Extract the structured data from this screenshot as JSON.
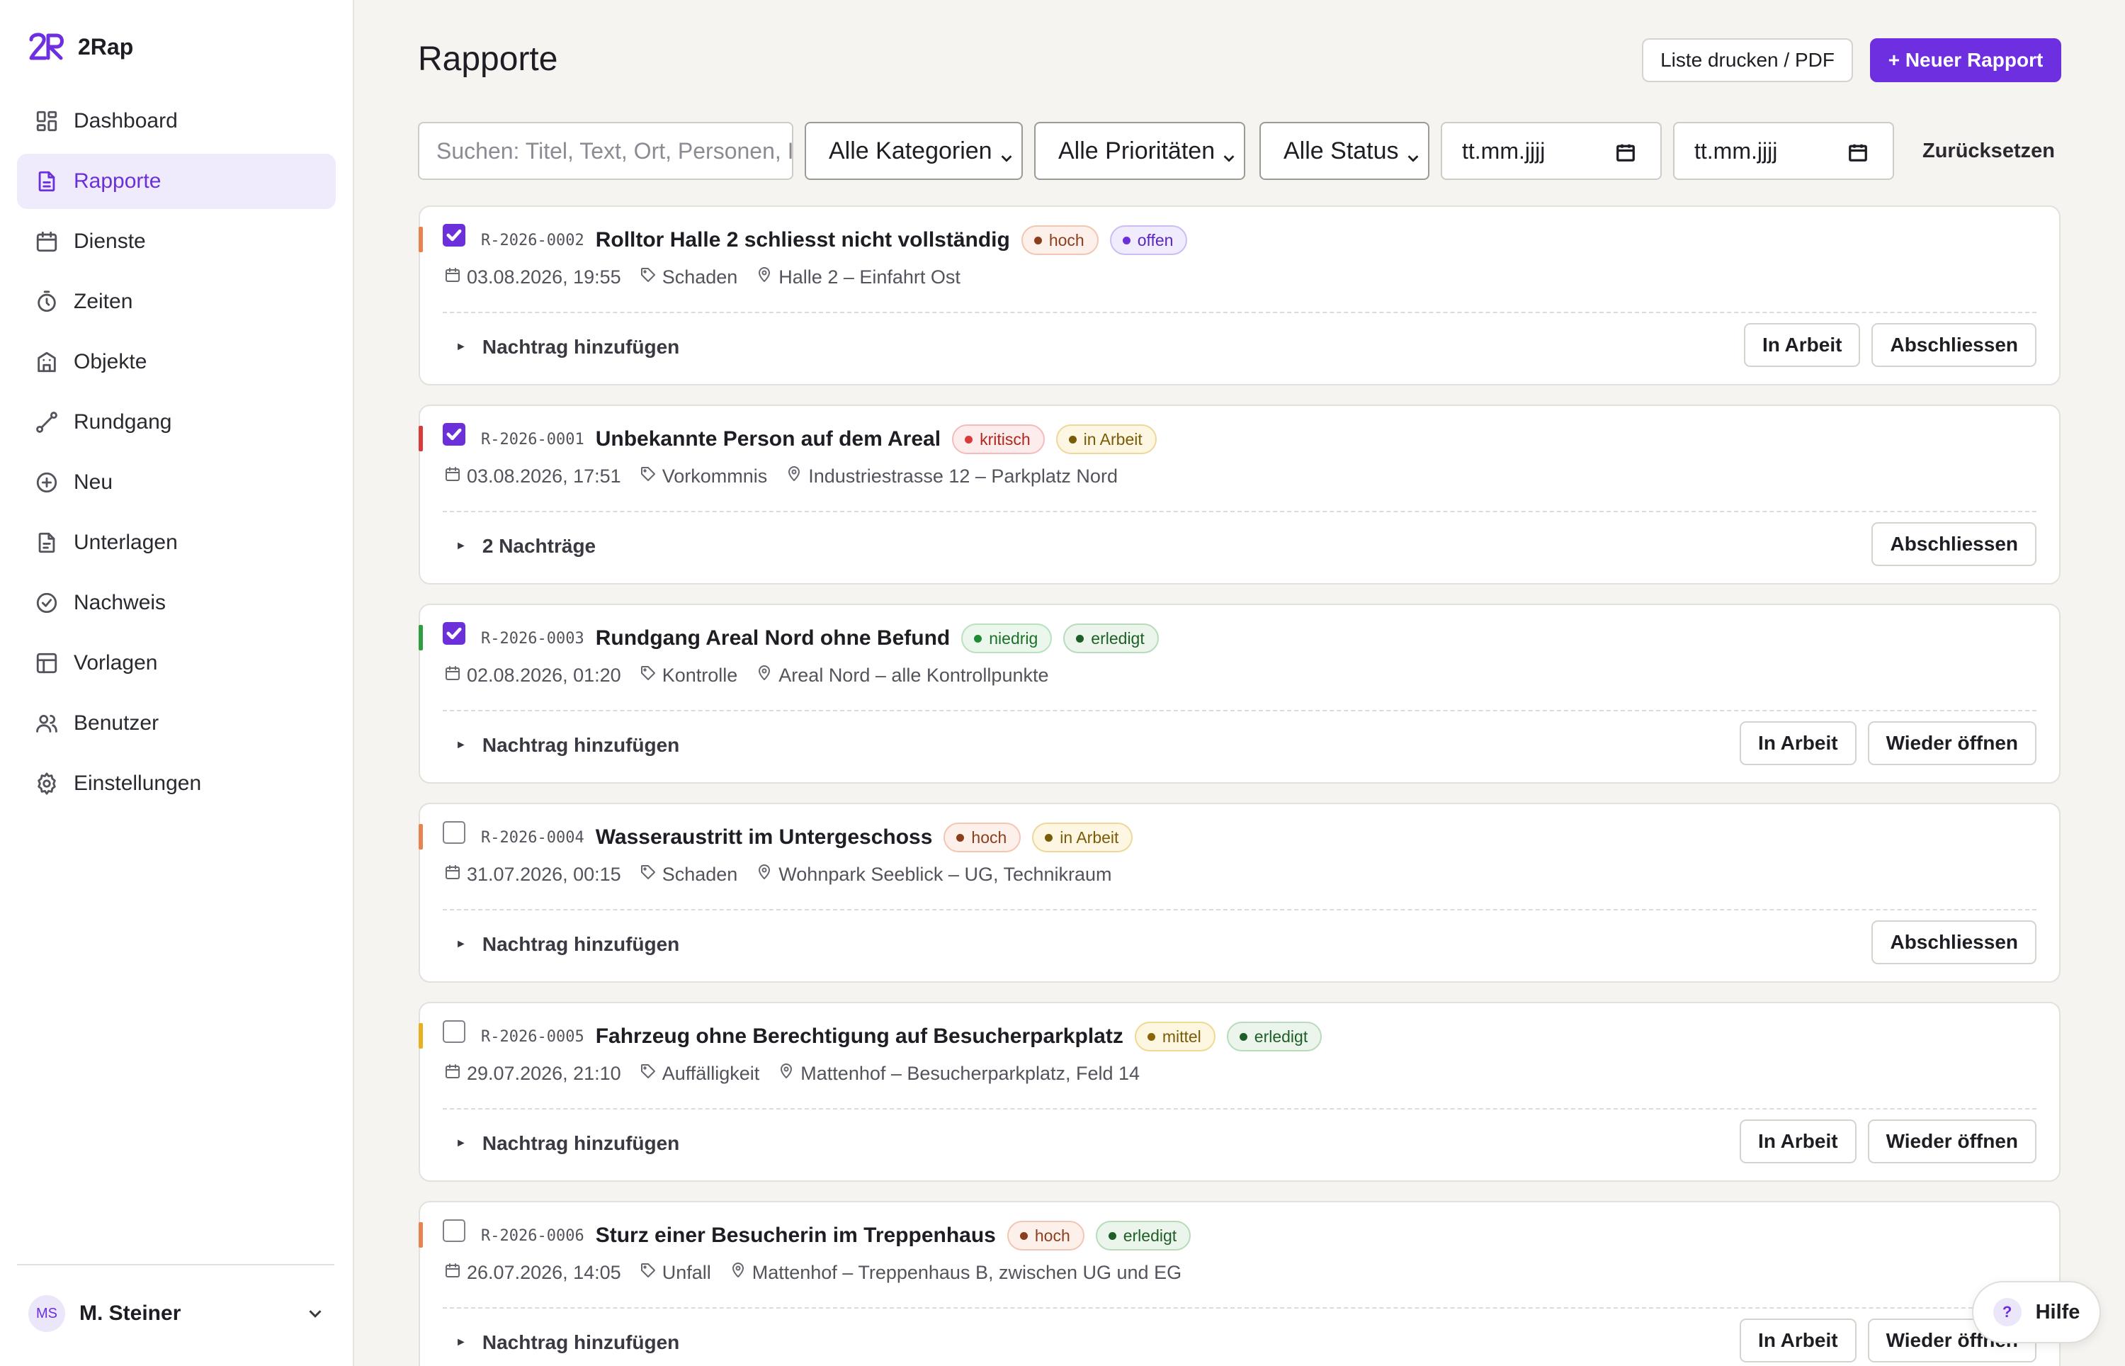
{
  "app": {
    "name": "2Rap"
  },
  "sidebar": {
    "items": [
      {
        "label": "Dashboard",
        "icon": "dashboard-icon"
      },
      {
        "label": "Rapporte",
        "icon": "document-icon",
        "active": true
      },
      {
        "label": "Dienste",
        "icon": "calendar-icon"
      },
      {
        "label": "Zeiten",
        "icon": "stopwatch-icon"
      },
      {
        "label": "Objekte",
        "icon": "building-icon"
      },
      {
        "label": "Rundgang",
        "icon": "route-icon"
      },
      {
        "label": "Neu",
        "icon": "plus-circle-icon"
      },
      {
        "label": "Unterlagen",
        "icon": "file-icon"
      },
      {
        "label": "Nachweis",
        "icon": "check-circle-icon"
      },
      {
        "label": "Vorlagen",
        "icon": "layout-icon"
      },
      {
        "label": "Benutzer",
        "icon": "users-icon"
      },
      {
        "label": "Einstellungen",
        "icon": "gear-icon"
      }
    ],
    "user": {
      "initials": "MS",
      "name": "M. Steiner"
    }
  },
  "header": {
    "title": "Rapporte",
    "print_label": "Liste drucken / PDF",
    "new_label": "+ Neuer Rapport"
  },
  "filters": {
    "search_placeholder": "Suchen: Titel, Text, Ort, Personen, I",
    "category": "Alle Kategorien",
    "priority": "Alle Prioritäten",
    "status": "Alle Status",
    "date_from": "tt.mm.jjjj",
    "date_to": "tt.mm.jjjj",
    "reset_label": "Zurücksetzen"
  },
  "colors": {
    "accent": "#6d2fe0",
    "priority_hoch": "#e8834e",
    "priority_kritisch": "#d93a3a",
    "priority_niedrig": "#2f9e41",
    "priority_mittel": "#e6b020"
  },
  "reports": [
    {
      "id": "R-2026-0002",
      "title": "Rolltor Halle 2 schliesst nicht vollständig",
      "priority": "hoch",
      "status": "offen",
      "checked": true,
      "date": "03.08.2026, 19:55",
      "category": "Schaden",
      "location": "Halle 2 – Einfahrt Ost",
      "footer": "Nachtrag hinzufügen",
      "actions": [
        "In Arbeit",
        "Abschliessen"
      ]
    },
    {
      "id": "R-2026-0001",
      "title": "Unbekannte Person auf dem Areal",
      "priority": "kritisch",
      "status": "in Arbeit",
      "checked": true,
      "date": "03.08.2026, 17:51",
      "category": "Vorkommnis",
      "location": "Industriestrasse 12 – Parkplatz Nord",
      "footer": "2 Nachträge",
      "actions": [
        "Abschliessen"
      ]
    },
    {
      "id": "R-2026-0003",
      "title": "Rundgang Areal Nord ohne Befund",
      "priority": "niedrig",
      "status": "erledigt",
      "checked": true,
      "date": "02.08.2026, 01:20",
      "category": "Kontrolle",
      "location": "Areal Nord – alle Kontrollpunkte",
      "footer": "Nachtrag hinzufügen",
      "actions": [
        "In Arbeit",
        "Wieder öffnen"
      ]
    },
    {
      "id": "R-2026-0004",
      "title": "Wasseraustritt im Untergeschoss",
      "priority": "hoch",
      "status": "in Arbeit",
      "checked": false,
      "date": "31.07.2026, 00:15",
      "category": "Schaden",
      "location": "Wohnpark Seeblick – UG, Technikraum",
      "footer": "Nachtrag hinzufügen",
      "actions": [
        "Abschliessen"
      ]
    },
    {
      "id": "R-2026-0005",
      "title": "Fahrzeug ohne Berechtigung auf Besucherparkplatz",
      "priority": "mittel",
      "status": "erledigt",
      "checked": false,
      "date": "29.07.2026, 21:10",
      "category": "Auffälligkeit",
      "location": "Mattenhof – Besucherparkplatz, Feld 14",
      "footer": "Nachtrag hinzufügen",
      "actions": [
        "In Arbeit",
        "Wieder öffnen"
      ]
    },
    {
      "id": "R-2026-0006",
      "title": "Sturz einer Besucherin im Treppenhaus",
      "priority": "hoch",
      "status": "erledigt",
      "checked": false,
      "date": "26.07.2026, 14:05",
      "category": "Unfall",
      "location": "Mattenhof – Treppenhaus B, zwischen UG und EG",
      "footer": "Nachtrag hinzufügen",
      "actions": [
        "In Arbeit",
        "Wieder öffnen"
      ]
    }
  ],
  "help": {
    "icon_glyph": "?",
    "label": "Hilfe"
  }
}
